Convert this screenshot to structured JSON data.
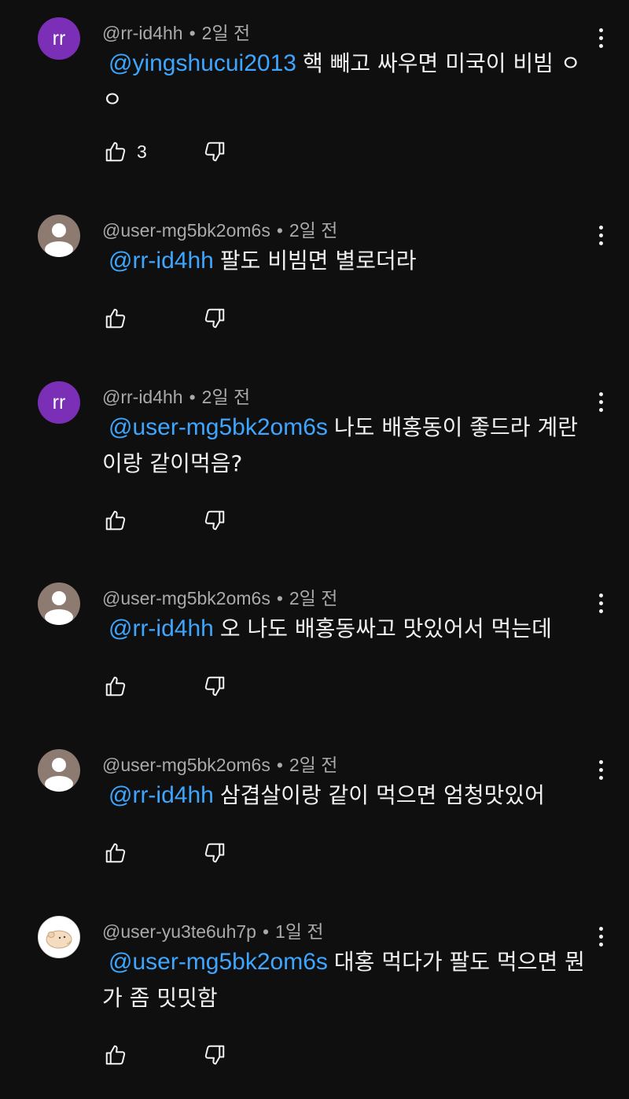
{
  "comments": [
    {
      "author": "@rr-id4hh",
      "time": "2일 전",
      "mention": "@yingshucui2013",
      "text": "핵 빼고 싸우면 미국이 비빔 ㅇㅇ",
      "likes": "3",
      "avatar": {
        "type": "letter",
        "text": "rr",
        "color": "#7a2fb6"
      }
    },
    {
      "author": "@user-mg5bk2om6s",
      "time": "2일 전",
      "mention": "@rr-id4hh",
      "text": "팔도 비빔면 별로더라",
      "likes": "",
      "avatar": {
        "type": "default-person",
        "color": "#8d7b71"
      }
    },
    {
      "author": "@rr-id4hh",
      "time": "2일 전",
      "mention": "@user-mg5bk2om6s",
      "text": "나도 배홍동이 좋드라 계란이랑 같이먹음?",
      "likes": "",
      "avatar": {
        "type": "letter",
        "text": "rr",
        "color": "#7a2fb6"
      }
    },
    {
      "author": "@user-mg5bk2om6s",
      "time": "2일 전",
      "mention": "@rr-id4hh",
      "text": "오 나도 배홍동싸고 맛있어서 먹는데",
      "likes": "",
      "avatar": {
        "type": "default-person",
        "color": "#8d7b71"
      }
    },
    {
      "author": "@user-mg5bk2om6s",
      "time": "2일 전",
      "mention": "@rr-id4hh",
      "text": "삼겹살이랑 같이 먹으면 엄청맛있어",
      "likes": "",
      "avatar": {
        "type": "default-person",
        "color": "#8d7b71"
      }
    },
    {
      "author": "@user-yu3te6uh7p",
      "time": "1일 전",
      "mention": "@user-mg5bk2om6s",
      "text": "대홍 먹다가 팔도 먹으면 뭔가 좀 밋밋함",
      "likes": "",
      "avatar": {
        "type": "hamster-drawing",
        "color": "#ffffff"
      }
    }
  ],
  "icons": {
    "like": "thumb-up-icon",
    "dislike": "thumb-down-icon",
    "more": "more-vert-icon"
  },
  "colors": {
    "background": "#0f0f0f",
    "mention": "#3ea6ff",
    "meta": "#aaaaaa",
    "text": "#f1f1f1"
  }
}
